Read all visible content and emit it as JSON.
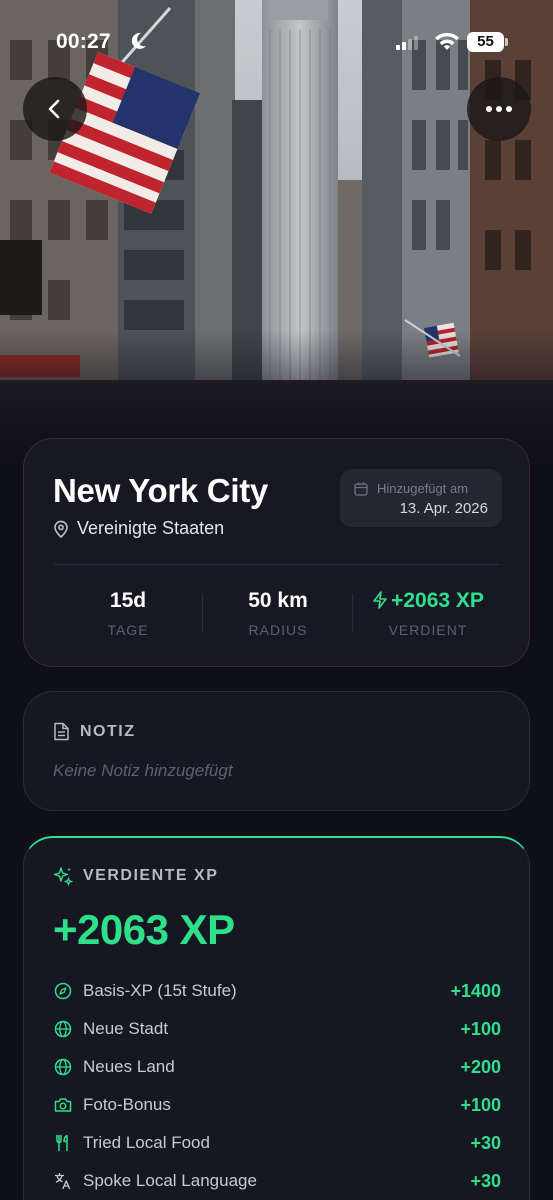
{
  "status_bar": {
    "time": "00:27",
    "battery": "55"
  },
  "city": {
    "name": "New York City",
    "country": "Vereinigte Staaten",
    "added_label": "Hinzugefügt am",
    "added_date": "13. Apr. 2026"
  },
  "stats": [
    {
      "value": "15d",
      "label": "TAGE"
    },
    {
      "value": "50 km",
      "label": "RADIUS"
    },
    {
      "value": "+2063 XP",
      "label": "VERDIENT"
    }
  ],
  "note": {
    "title": "NOTIZ",
    "empty_text": "Keine Notiz hinzugefügt"
  },
  "xp": {
    "title": "VERDIENTE XP",
    "total": "+2063 XP",
    "items": [
      {
        "icon": "compass-icon",
        "label": "Basis-XP (15t Stufe)",
        "value": "+1400"
      },
      {
        "icon": "globe-icon",
        "label": "Neue Stadt",
        "value": "+100"
      },
      {
        "icon": "globe-icon",
        "label": "Neues Land",
        "value": "+200"
      },
      {
        "icon": "camera-icon",
        "label": "Foto-Bonus",
        "value": "+100"
      },
      {
        "icon": "utensils-icon",
        "label": "Tried Local Food",
        "value": "+30"
      },
      {
        "icon": "translate-icon",
        "label": "Spoke Local Language",
        "value": "+30"
      }
    ]
  },
  "colors": {
    "accent": "#2fe08b",
    "background": "#0f0f1a",
    "card": "#171723"
  }
}
